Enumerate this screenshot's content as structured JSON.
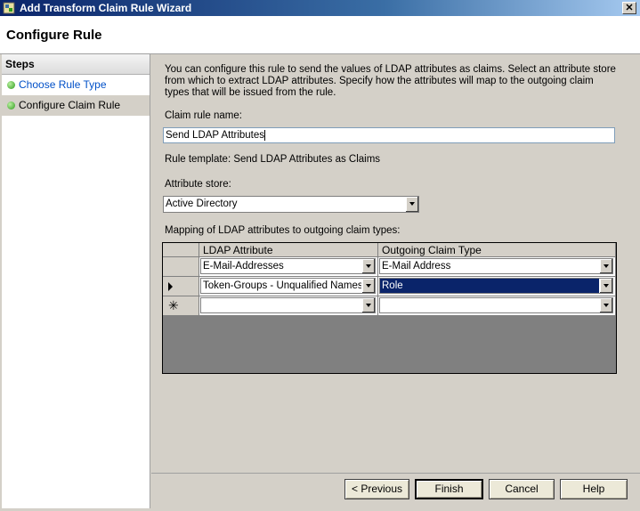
{
  "window": {
    "title": "Add Transform Claim Rule Wizard",
    "close_glyph": "✕"
  },
  "header": {
    "title": "Configure Rule"
  },
  "steps": {
    "title": "Steps",
    "items": [
      {
        "label": "Choose Rule Type"
      },
      {
        "label": "Configure Claim Rule"
      }
    ]
  },
  "content": {
    "description": "You can configure this rule to send the values of LDAP attributes as claims. Select an attribute store from which to extract LDAP attributes. Specify how the attributes will map to the outgoing claim types that will be issued from the rule.",
    "claim_rule_name_label": "Claim rule name:",
    "claim_rule_name_value": "Send LDAP Attributes",
    "rule_template": "Rule template: Send LDAP Attributes as Claims",
    "attribute_store_label": "Attribute store:",
    "attribute_store_value": "Active Directory",
    "mapping_label": "Mapping of LDAP attributes to outgoing claim types:",
    "columns": [
      "LDAP Attribute",
      "Outgoing Claim Type"
    ],
    "rows": [
      {
        "ldap": "E-Mail-Addresses",
        "claim": "E-Mail Address"
      },
      {
        "ldap": "Token-Groups - Unqualified Names",
        "claim": "Role"
      },
      {
        "ldap": "",
        "claim": ""
      }
    ],
    "new_row_glyph": "✳"
  },
  "footer": {
    "previous": "< Previous",
    "finish": "Finish",
    "cancel": "Cancel",
    "help": "Help"
  }
}
